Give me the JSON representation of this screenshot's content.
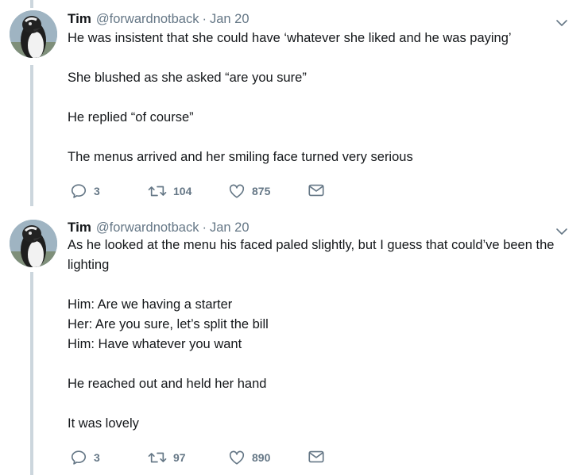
{
  "tweets": [
    {
      "name": "Tim",
      "handle": "@forwardnotback",
      "separator": "·",
      "date": "Jan 20",
      "paragraphs": [
        "He was insistent that she could have ‘whatever she liked and he was paying’",
        "She blushed as she asked “are you sure”",
        "He replied “of course”",
        "The menus arrived and her smiling face turned very serious"
      ],
      "replies": "3",
      "retweets": "104",
      "likes": "875"
    },
    {
      "name": "Tim",
      "handle": "@forwardnotback",
      "separator": "·",
      "date": "Jan 20",
      "paragraphs": [
        "As he looked at the menu his faced paled slightly, but I guess that could’ve been the lighting",
        "Him: Are we having a starter\nHer: Are you sure, let’s split the bill\nHim: Have whatever you want",
        "He reached out and held her hand",
        "It was lovely"
      ],
      "replies": "3",
      "retweets": "97",
      "likes": "890"
    }
  ],
  "icons": {
    "reply": "reply-icon",
    "retweet": "retweet-icon",
    "like": "heart-icon",
    "dm": "envelope-icon",
    "more": "chevron-down-icon",
    "avatar": "penguin-avatar"
  },
  "colors": {
    "text": "#14171a",
    "muted": "#657786",
    "thread_line": "#ccd6dd"
  }
}
